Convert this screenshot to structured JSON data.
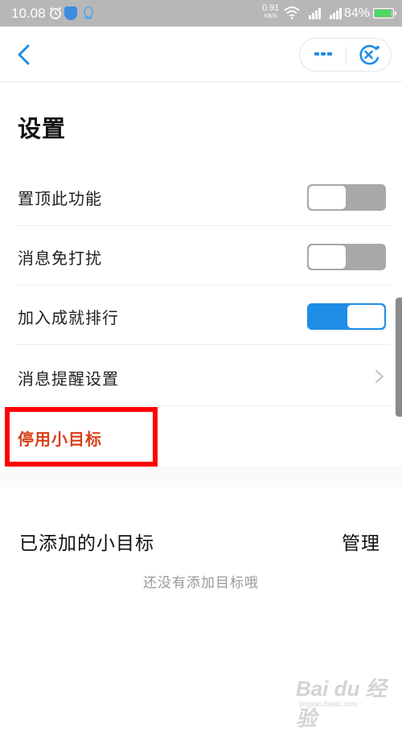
{
  "status_bar": {
    "time": "10.08",
    "net_speed_value": "0.91",
    "net_speed_unit": "KB/S",
    "battery_percent": "84%",
    "battery_level": 0.84,
    "battery_color": "#4cd964"
  },
  "nav": {
    "back_icon": "chevron-left-icon",
    "more_icon": "more-dots-icon",
    "close_icon": "close-target-icon",
    "accent_color": "#1f8de6"
  },
  "page": {
    "title": "设置"
  },
  "settings": [
    {
      "label": "置顶此功能",
      "control": "toggle",
      "on": false
    },
    {
      "label": "消息免打扰",
      "control": "toggle",
      "on": false
    },
    {
      "label": "加入成就排行",
      "control": "toggle",
      "on": true
    },
    {
      "label": "消息提醒设置",
      "control": "chevron"
    }
  ],
  "disable_goal": {
    "label": "停用小目标",
    "color": "#d9401a",
    "highlight_color": "#ff0000"
  },
  "goals_section": {
    "title": "已添加的小目标",
    "manage_label": "管理",
    "empty_text": "还没有添加目标哦"
  },
  "watermark": {
    "logo": "Bai du 经验",
    "domain": "jingyan.baidu.com"
  }
}
